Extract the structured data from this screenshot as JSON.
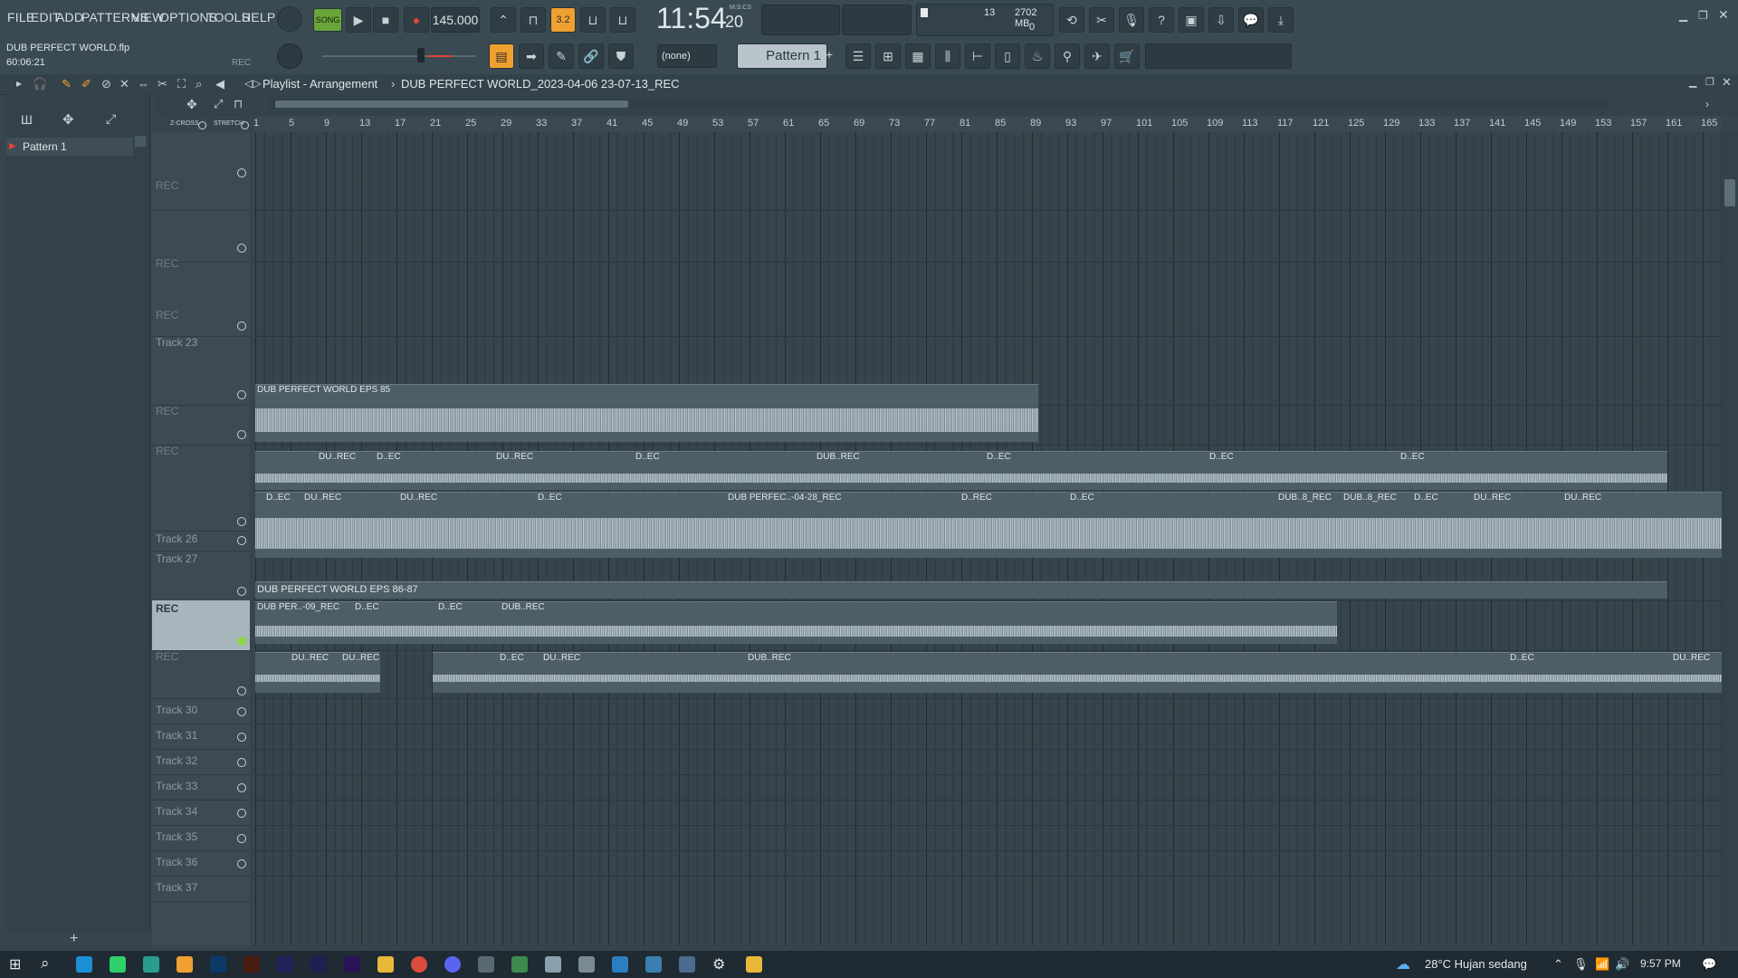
{
  "menu": [
    "FILE",
    "EDIT",
    "ADD",
    "PATTERNS",
    "VIEW",
    "OPTIONS",
    "TOOLS",
    "HELP"
  ],
  "transport": {
    "mode": "SONG",
    "tempo": "145.000",
    "clock": "11:54",
    "clock_small": "20",
    "clock_unit": "M:S:CS",
    "step": "3.2"
  },
  "meters": {
    "cpu": "13",
    "memory": "2702 MB",
    "polyphony": "0"
  },
  "project": {
    "file": "DUB PERFECT WORLD.flp",
    "time": "60:06:21",
    "rec": "REC"
  },
  "toolbar2": {
    "snap": "(none)",
    "pattern": "Pattern 1"
  },
  "playlist": {
    "title": "Playlist - Arrangement",
    "breadcrumb": "DUB PERFECT WORLD_2023-04-06 23-07-13_REC"
  },
  "options": {
    "zcross": "Z-CROSS",
    "stretch": "STRETCH"
  },
  "ruler": [
    "1",
    "5",
    "9",
    "13",
    "17",
    "21",
    "25",
    "29",
    "33",
    "37",
    "41",
    "45",
    "49",
    "53",
    "57",
    "61",
    "65",
    "69",
    "73",
    "77",
    "81",
    "85",
    "89",
    "93",
    "97",
    "101",
    "105",
    "109",
    "113",
    "117",
    "121",
    "125",
    "129",
    "133",
    "137",
    "141",
    "145",
    "149",
    "153",
    "157",
    "161",
    "165"
  ],
  "patterns": [
    "Pattern 1"
  ],
  "tracks": [
    {
      "label": "REC"
    },
    {
      "label": "REC"
    },
    {
      "label": "REC"
    },
    {
      "label": "Track 23"
    },
    {
      "label": "REC"
    },
    {
      "label": "REC"
    },
    {
      "label": "Track 26"
    },
    {
      "label": "Track 27"
    },
    {
      "label": "REC"
    },
    {
      "label": "REC"
    },
    {
      "label": "Track 30"
    },
    {
      "label": "Track 31"
    },
    {
      "label": "Track 32"
    },
    {
      "label": "Track 33"
    },
    {
      "label": "Track 34"
    },
    {
      "label": "Track 35"
    },
    {
      "label": "Track 36"
    },
    {
      "label": "Track 37"
    }
  ],
  "clips": {
    "c23": "DUB PERFECT WORLD EPS 85",
    "c24a": "DU..REC",
    "c24b": "D..EC",
    "c24c": "DU..REC",
    "c24d": "D..EC",
    "c24e": "DUB..REC",
    "c24f": "D..EC",
    "c24g": "D..EC",
    "c24h": "D..EC",
    "c25a": "D..EC",
    "c25b": "DU..REC",
    "c25c": "DU..REC",
    "c25d": "D..EC",
    "c25e": "DUB PERFEC..-04-28_REC",
    "c25f": "D..REC",
    "c25g": "D..EC",
    "c25h": "DUB..8_REC",
    "c25i": "DUB..8_REC",
    "c25j": "D..EC",
    "c25k": "DU..REC",
    "c25l": "DU..REC",
    "c26": "DUB PERFECT WORLD EPS 86-87",
    "c27a": "DUB PER..-09_REC",
    "c27b": "D..EC",
    "c27c": "D..EC",
    "c27d": "DUB..REC",
    "c28a": "DU..REC",
    "c28b": "DU..REC",
    "c28c": "D..EC",
    "c28d": "DU..REC",
    "c28e": "DUB..REC",
    "c28f": "D..EC",
    "c28g": "DU..REC"
  },
  "taskbar": {
    "weather": "28°C  Hujan sedang",
    "time": "9:57 PM"
  }
}
